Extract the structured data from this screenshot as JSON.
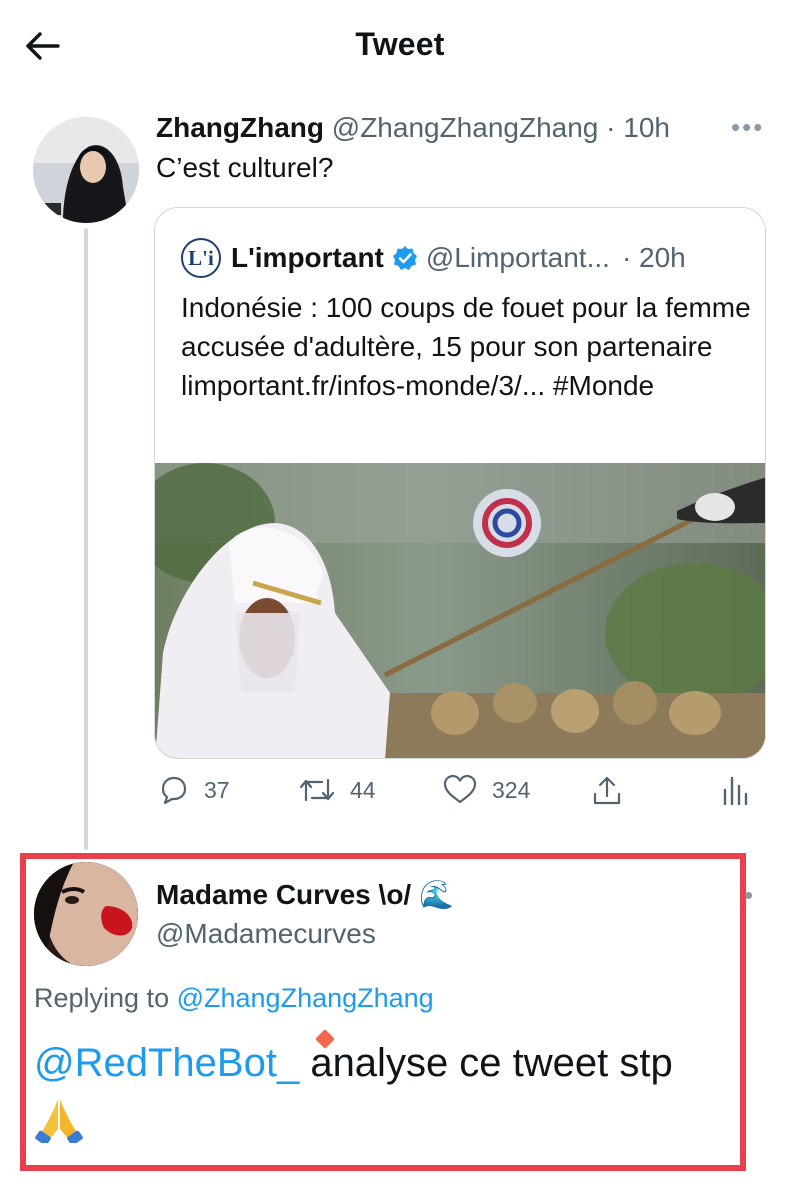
{
  "header": {
    "title": "Tweet"
  },
  "tweet": {
    "author_name": "ZhangZhang",
    "author_handle": "@ZhangZhangZhang",
    "time": "· 10h",
    "text": "C’est culturel?",
    "more_icon": "more-horizontal-icon"
  },
  "quote": {
    "logo_text": "L'i",
    "author_name": "L'important",
    "author_handle": "@Limportant...",
    "time": "· 20h",
    "text": "Indonésie : 100 coups de fouet pour la femme accusée d'adultère, 15 pour son partenaire limportant.fr/infos-monde/3/... #Monde"
  },
  "actions": {
    "reply_count": "37",
    "retweet_count": "44",
    "like_count": "324"
  },
  "reply": {
    "author_name": "Madame Curves \\o/",
    "author_emoji": "🌊",
    "author_handle": "@Madamecurves",
    "replying_label": "Replying to",
    "replying_handle": "@ZhangZhangZhang",
    "mention": "@RedTheBot_",
    "text": " analyse ce tweet stp",
    "emoji": "🙏"
  },
  "colors": {
    "link": "#1d9bf0",
    "muted": "#536471",
    "highlight_border": "#e8404d",
    "verified": "#1d9bf0"
  }
}
